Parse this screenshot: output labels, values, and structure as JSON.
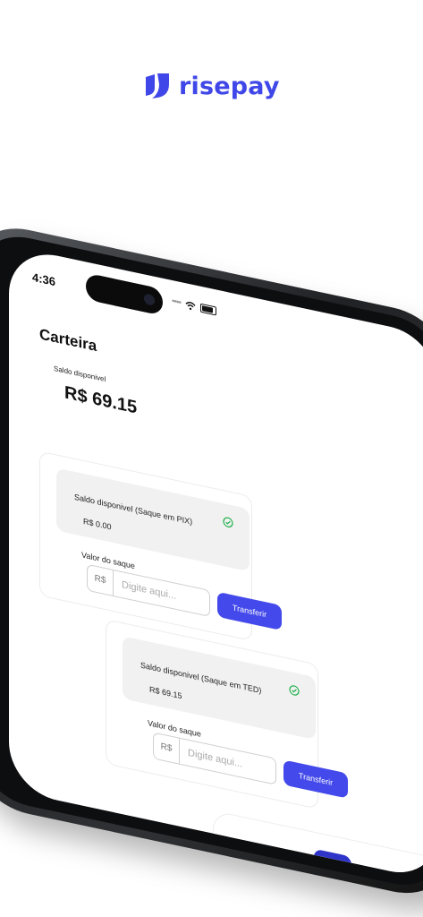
{
  "brand": {
    "name": "risepay",
    "color": "#4047e8",
    "logo_icon": "risepay-logo-icon"
  },
  "status_bar": {
    "time": "4:36",
    "icons": [
      "signal-dots-icon",
      "wifi-icon",
      "battery-icon"
    ]
  },
  "page": {
    "title": "Carteira",
    "balance_label": "Saldo disponivel",
    "balance_value": "R$ 69.15"
  },
  "cards": [
    {
      "title": "Saldo disponivel (Saque em PIX)",
      "amount": "R$ 0.00",
      "status_icon": "check-circle-icon",
      "input_label": "Valor do saque",
      "currency_prefix": "R$",
      "input_placeholder": "Digite aqui...",
      "button_label": "Transferir"
    },
    {
      "title": "Saldo disponivel (Saque em TED)",
      "amount": "R$ 69.15",
      "status_icon": "check-circle-icon",
      "input_label": "Valor do saque",
      "currency_prefix": "R$",
      "input_placeholder": "Digite aqui...",
      "button_label": "Transferir"
    }
  ],
  "tab_bar": {
    "items": [
      {
        "icon": "home-icon",
        "active": false
      },
      {
        "icon": "wallet-icon",
        "active": true
      },
      {
        "icon": "gear-icon",
        "active": false
      }
    ],
    "active_color": "#2f35c8"
  },
  "colors": {
    "accent": "#4349ea",
    "success": "#22b14c"
  }
}
